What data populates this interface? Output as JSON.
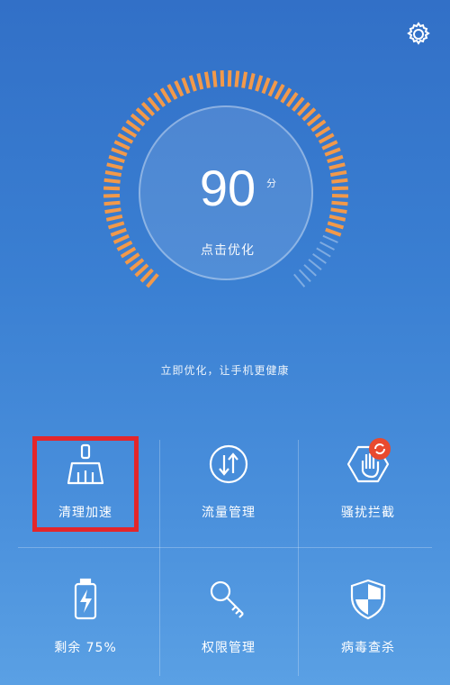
{
  "colors": {
    "accent": "#f2994a",
    "highlight": "#e3262b",
    "badge": "#e84a2f"
  },
  "header": {
    "settings_icon": "gear-icon"
  },
  "gauge": {
    "score": "90",
    "unit": "分",
    "action_label": "点击优化",
    "progress": 0.9
  },
  "hint": "立即优化，让手机更健康",
  "tools": [
    {
      "label": "清理加速",
      "icon": "broom-icon"
    },
    {
      "label": "流量管理",
      "icon": "transfer-icon"
    },
    {
      "label": "骚扰拦截",
      "icon": "hand-block-icon"
    },
    {
      "label": "剩余 75%",
      "icon": "battery-icon"
    },
    {
      "label": "权限管理",
      "icon": "key-icon"
    },
    {
      "label": "病毒查杀",
      "icon": "shield-icon"
    }
  ]
}
